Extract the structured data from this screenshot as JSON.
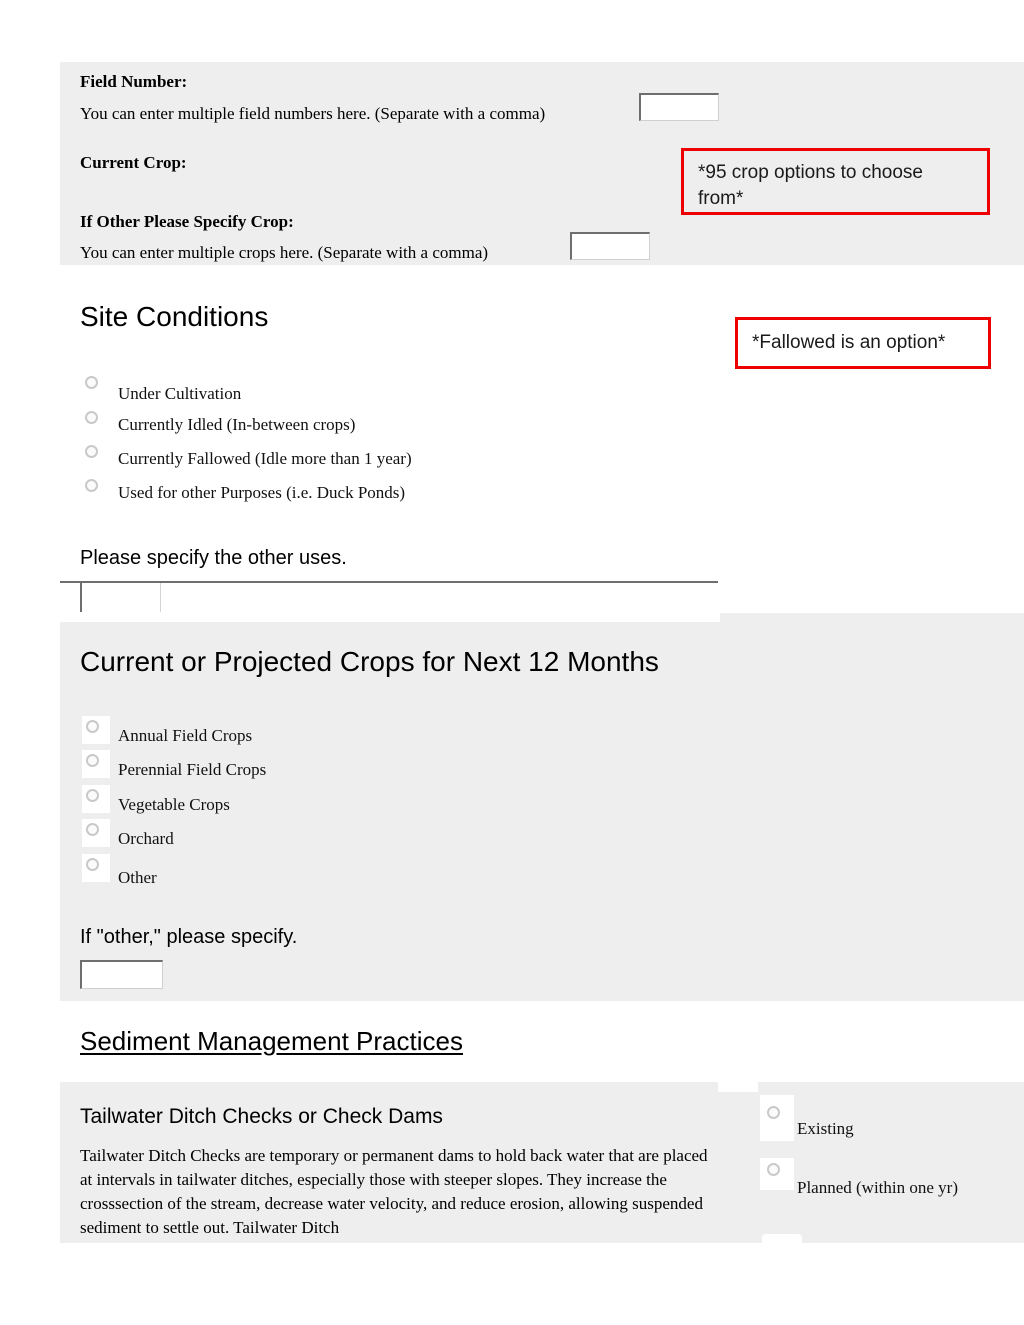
{
  "section_field": {
    "field_number_label": "Field Number:",
    "field_number_hint": "You can enter multiple field numbers here. (Separate with a comma)",
    "field_number_value": "",
    "current_crop_label": "Current Crop:",
    "other_crop_label": "If Other Please Specify Crop:",
    "other_crop_hint": "You can enter multiple crops here. (Separate with a comma)",
    "other_crop_value": ""
  },
  "callouts": [
    {
      "text": "*95 crop options to choose from*",
      "color": "#ee0000"
    },
    {
      "text": "*Fallowed is an option*",
      "color": "#ee0000"
    }
  ],
  "site_conditions": {
    "heading": "Site Conditions",
    "options": [
      "Under Cultivation",
      "Currently Idled (In-between crops)",
      "Currently Fallowed (Idle more than 1 year)",
      "Used for other Purposes (i.e. Duck Ponds)"
    ],
    "other_uses_prompt": "Please specify the other uses.",
    "other_uses_value": ""
  },
  "projected_crops": {
    "heading": "Current or Projected Crops for Next 12 Months",
    "options": [
      "Annual Field Crops",
      "Perennial Field Crops",
      "Vegetable Crops",
      "Orchard",
      "Other"
    ],
    "other_prompt": "If \"other,\" please specify.",
    "other_value": ""
  },
  "sediment": {
    "heading": "Sediment Management Practices",
    "practice_title": "Tailwater Ditch Checks or Check Dams",
    "practice_body": "Tailwater Ditch Checks are temporary or permanent dams to hold back water that are placed at intervals in tailwater ditches, especially those with steeper slopes. They increase the crosssection of the stream, decrease water velocity, and reduce erosion, allowing suspended sediment to settle out. Tailwater Ditch",
    "status_options": [
      "Existing",
      "Planned (within one yr)"
    ]
  }
}
